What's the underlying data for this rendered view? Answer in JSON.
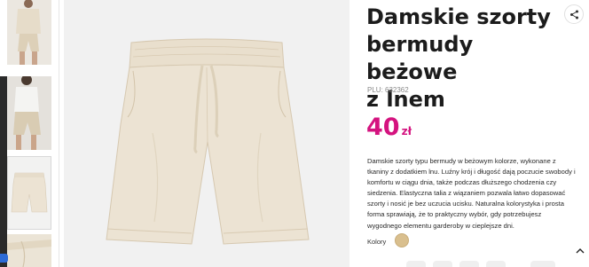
{
  "product": {
    "title_lines": [
      "Damskie szorty",
      "bermudy beżowe",
      "z lnem"
    ],
    "plu": "PLU: 632362",
    "price": {
      "amount": "40",
      "currency": "zł"
    },
    "description": "Damskie szorty typu bermudy w beżowym kolorze, wykonane z tkaniny z dodatkiem lnu. Luźny krój i długość dają poczucie swobody i komfortu w ciągu dnia, także podczas dłuższego chodzenia czy siedzenia. Elastyczna talia z wiązaniem pozwala łatwo dopasować szorty i nosić je bez uczucia ucisku. Naturalna kolorystyka i prosta forma sprawiają, że to praktyczny wybór, gdy potrzebujesz wygodnego elementu garderoby w cieplejsze dni.",
    "colors_label": "Kolory"
  },
  "colors": {
    "accent": "#d4137f",
    "swatch_beige": "#d9bf8e",
    "fabric": "#ece3d3"
  },
  "icons": {
    "share": "share-icon",
    "scroll_up": "chevron-up-icon"
  }
}
